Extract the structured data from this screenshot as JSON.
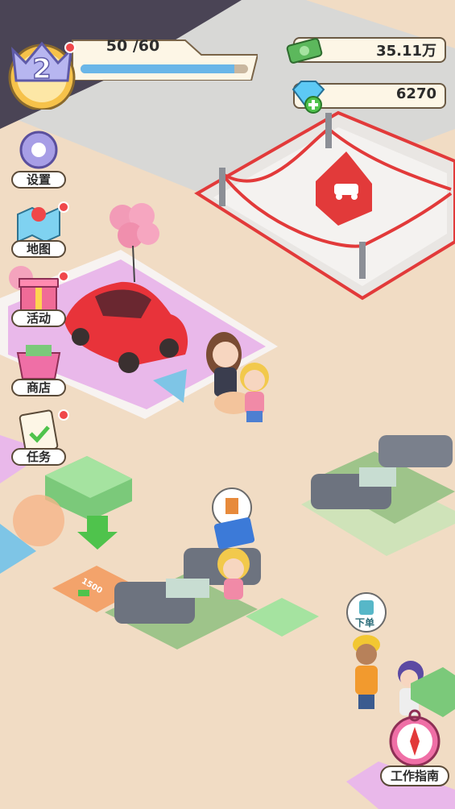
{
  "hud": {
    "level": "2",
    "xp_text": "50 /60",
    "xp_progress": 0.92,
    "money": "35.11万",
    "gems": "6270"
  },
  "side_menu": [
    {
      "label": "设置",
      "icon": "gear-icon",
      "badge": false
    },
    {
      "label": "地图",
      "icon": "map-icon",
      "badge": true
    },
    {
      "label": "活动",
      "icon": "gift-icon",
      "badge": true
    },
    {
      "label": "商店",
      "icon": "shop-basket-icon",
      "badge": false
    },
    {
      "label": "任务",
      "icon": "clipboard-icon",
      "badge": true
    }
  ],
  "guide": {
    "label": "工作指南",
    "icon": "compass-icon"
  },
  "floor_items": {
    "price_tile": "1500",
    "order_bubble": "下单"
  },
  "colors": {
    "floor": "#f1dcc4",
    "pink_platform": "#e9b8ea",
    "car": "#e8333a",
    "accent_red": "#e23a3a",
    "xp_blue": "#6ab6e8"
  }
}
